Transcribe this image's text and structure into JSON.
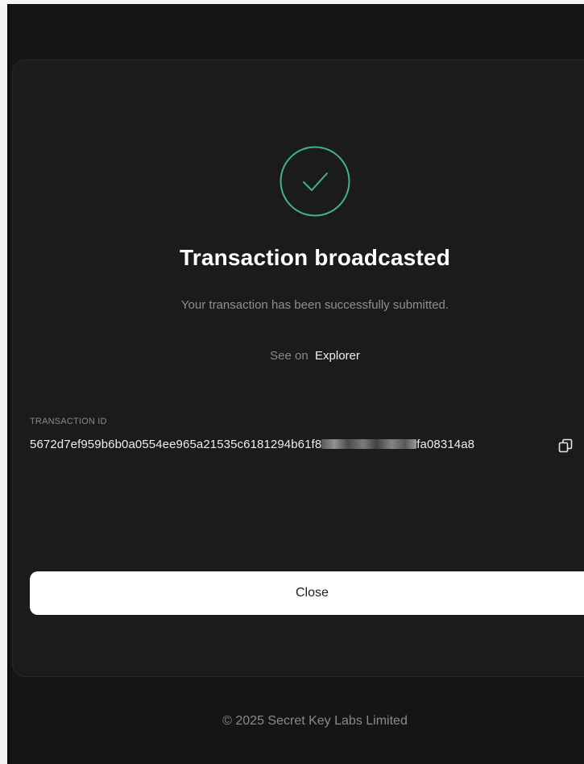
{
  "dialog": {
    "title": "Transaction broadcasted",
    "subtitle": "Your transaction has been successfully submitted.",
    "explorer_prefix": "See on",
    "explorer_link": "Explorer",
    "status_icon": "check-circle-icon"
  },
  "transaction": {
    "label": "TRANSACTION ID",
    "id_start": "5672d7ef959b6b0a0554ee965a21535c6181294b61f8",
    "id_end": "fa08314a8",
    "copy_icon": "copy-icon"
  },
  "actions": {
    "close_label": "Close"
  },
  "footer": {
    "copyright": "© 2025 Secret Key Labs Limited"
  },
  "colors": {
    "background": "#151515",
    "card": "#1b1b1b",
    "success_accent": "#3fb58a",
    "button_bg": "#ffffff",
    "muted_text": "#8a8a8a"
  }
}
